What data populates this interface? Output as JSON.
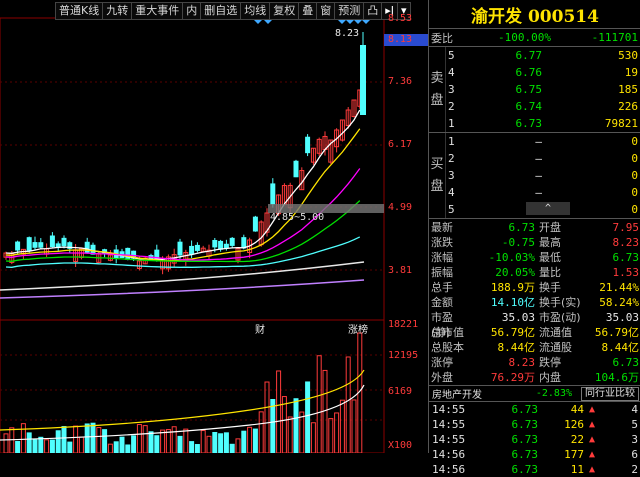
{
  "toolbar": {
    "items": [
      "普通K线",
      "九转",
      "重大事件",
      "内",
      "删自选",
      "均线",
      "复权",
      "叠",
      "窗",
      "预测",
      "凸"
    ],
    "more_icon": "arrow-more-icon",
    "menu_icon": "menu-icon"
  },
  "chart": {
    "price_axis": [
      "8.53",
      "8.13",
      "7.36",
      "6.17",
      "4.99",
      "3.81"
    ],
    "volume_axis": [
      "18221",
      "12195",
      "6169",
      "X100"
    ],
    "high_label": "8.23",
    "range_label": "4.85~5.00",
    "event_labels": [
      "财",
      "涨榜"
    ]
  },
  "chart_data": {
    "type": "candlestick",
    "price_ticks": [
      8.53,
      7.36,
      6.17,
      4.99,
      3.81
    ],
    "volume_ticks": [
      18221,
      12195,
      6169
    ],
    "current_price": 8.13,
    "high_marker": 8.23,
    "range_annotation": "4.85~5.00"
  },
  "panel": {
    "title": "渝开发 000514",
    "webi": {
      "label": "委比",
      "pct": "-100.00%",
      "diff": "-111701"
    },
    "sell_label": [
      "卖",
      "盘"
    ],
    "buy_label": [
      "买",
      "盘"
    ],
    "sell": [
      {
        "lv": "5",
        "price": "6.77",
        "vol": "530"
      },
      {
        "lv": "4",
        "price": "6.76",
        "vol": "19"
      },
      {
        "lv": "3",
        "price": "6.75",
        "vol": "185"
      },
      {
        "lv": "2",
        "price": "6.74",
        "vol": "226"
      },
      {
        "lv": "1",
        "price": "6.73",
        "vol": "79821"
      }
    ],
    "buy": [
      {
        "lv": "1",
        "price": "–",
        "vol": "0"
      },
      {
        "lv": "2",
        "price": "–",
        "vol": "0"
      },
      {
        "lv": "3",
        "price": "–",
        "vol": "0"
      },
      {
        "lv": "4",
        "price": "–",
        "vol": "0"
      },
      {
        "lv": "5",
        "price": "–",
        "vol": "0"
      }
    ],
    "quote": [
      {
        "k1": "最新",
        "v1": "6.73",
        "k2": "开盘",
        "v2": "7.95"
      },
      {
        "k1": "涨跌",
        "v1": "-0.75",
        "k2": "最高",
        "v2": "8.23"
      },
      {
        "k1": "涨幅",
        "v1": "-10.03%",
        "k2": "最低",
        "v2": "6.73"
      },
      {
        "k1": "振幅",
        "v1": "20.05%",
        "k2": "量比",
        "v2": "1.53"
      },
      {
        "k1": "总手",
        "v1": "188.9万",
        "k2": "换手",
        "v2": "21.44%"
      },
      {
        "k1": "金额",
        "v1": "14.10亿",
        "k2": "换手(实)",
        "v2": "58.24%"
      },
      {
        "k1": "市盈(静)",
        "v1": "35.03",
        "k2": "市盈(动)",
        "v2": "35.03"
      },
      {
        "k1": "总市值",
        "v1": "56.79亿",
        "k2": "流通值",
        "v2": "56.79亿"
      },
      {
        "k1": "总股本",
        "v1": "8.44亿",
        "k2": "流通股",
        "v2": "8.44亿"
      },
      {
        "k1": "涨停",
        "v1": "8.23",
        "k2": "跌停",
        "v2": "6.73"
      },
      {
        "k1": "外盘",
        "v1": "76.29万",
        "k2": "内盘",
        "v2": "104.6万"
      }
    ],
    "sector": {
      "name": "房地产开发",
      "change": "-2.83%",
      "compare_btn": "同行业比较"
    },
    "ticks": [
      {
        "time": "14:55",
        "price": "6.73",
        "vol": "44",
        "n": "4"
      },
      {
        "time": "14:55",
        "price": "6.73",
        "vol": "126",
        "n": "5"
      },
      {
        "time": "14:55",
        "price": "6.73",
        "vol": "22",
        "n": "3"
      },
      {
        "time": "14:56",
        "price": "6.73",
        "vol": "177",
        "n": "6"
      },
      {
        "time": "14:56",
        "price": "6.73",
        "vol": "11",
        "n": "2"
      }
    ]
  }
}
